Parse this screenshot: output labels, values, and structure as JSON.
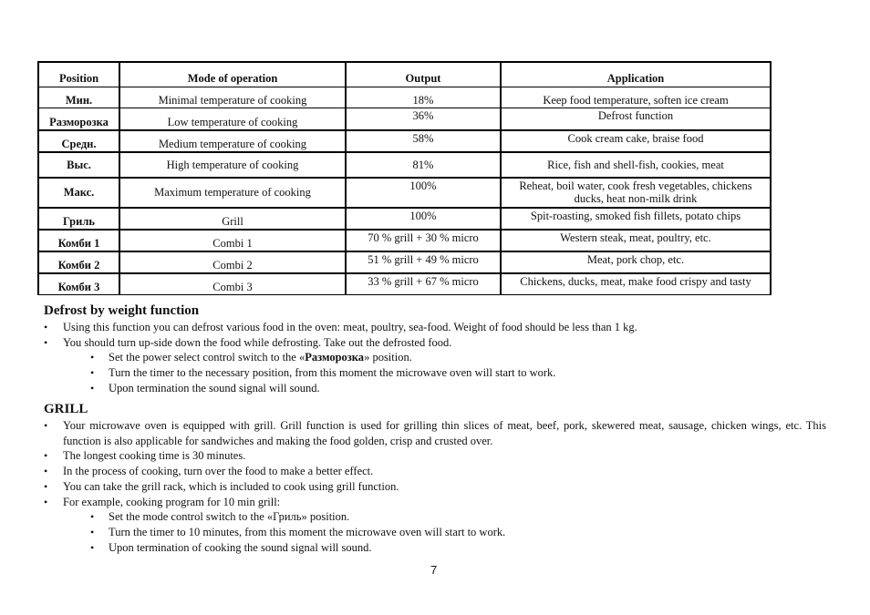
{
  "table": {
    "headers": [
      "Position",
      "Mode of operation",
      "Output",
      "Application"
    ],
    "rows": [
      {
        "position": "Мин.",
        "mode": "Minimal temperature of cooking",
        "output": "18%",
        "application": "Keep food temperature, soften ice cream"
      },
      {
        "position": "Разморозка",
        "mode": "Low temperature of cooking",
        "output": "36%",
        "application": "Defrost function"
      },
      {
        "position": "Средн.",
        "mode": "Medium temperature of cooking",
        "output": "58%",
        "application": "Cook cream cake, braise food"
      },
      {
        "position": "Выс.",
        "mode": "High temperature of cooking",
        "output": "81%",
        "application": "Rice, fish and shell-fish, cookies, meat"
      },
      {
        "position": "Макс.",
        "mode": "Maximum temperature of cooking",
        "output": "100%",
        "application": "Reheat, boil water, cook fresh vegetables, chickens ducks, heat non-milk drink"
      },
      {
        "position": "Гриль",
        "mode": "Grill",
        "output": "100%",
        "application": "Spit-roasting, smoked fish fillets, potato chips"
      },
      {
        "position": "Комби 1",
        "mode": "Combi 1",
        "output": "70 % grill + 30 % micro",
        "application": "Western steak, meat, poultry, etc."
      },
      {
        "position": "Комби 2",
        "mode": "Combi 2",
        "output": "51 % grill + 49 % micro",
        "application": "Meat, pork chop, etc."
      },
      {
        "position": "Комби 3",
        "mode": "Combi 3",
        "output": "33 % grill + 67 % micro",
        "application": "Chickens, ducks, meat, make food crispy and tasty"
      }
    ]
  },
  "defrost": {
    "title": "Defrost by weight function",
    "bullets": [
      "Using this function you can defrost various food in the oven: meat, poultry, sea-food. Weight of food should be less than 1 kg.",
      "You should turn up-side down the food while defrosting. Take out the defrosted food."
    ],
    "steps": {
      "step1_before": "Set the power select control switch to the «",
      "step1_bold": "Разморозка",
      "step1_after": "» position.",
      "step2": "Turn the timer to the necessary position, from this moment the microwave oven will start to work.",
      "step3": "Upon termination the sound signal will sound."
    }
  },
  "grill": {
    "title": "GRILL",
    "bullets": [
      "Your microwave oven is equipped with grill. Grill function is used for grilling thin slices of meat, beef, pork, skewered meat, sausage, chicken wings, etc. This function is also applicable for sandwiches and making the food golden, crisp and crusted over.",
      "The longest cooking time is 30 minutes.",
      "In the process of cooking, turn over the food to make a better effect.",
      "You can take the grill rack, which is included to cook using grill function.",
      "For example, cooking program for 10 min grill:"
    ],
    "steps": [
      "Set the mode control switch to the «Гриль» position.",
      "Turn the timer to 10 minutes, from this moment the microwave oven will start to work.",
      "Upon termination of cooking the sound signal will sound."
    ]
  },
  "bullet_glyph": "•",
  "page_number": "7"
}
